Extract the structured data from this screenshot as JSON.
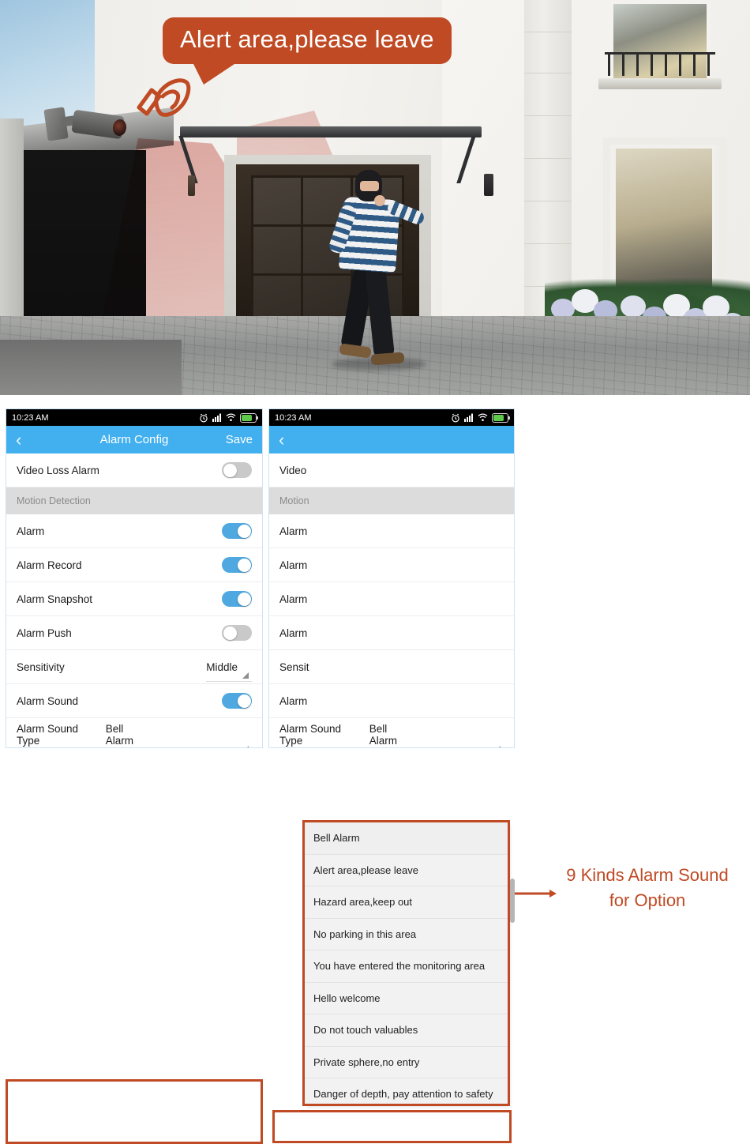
{
  "hero": {
    "bubble_text": "Alert area,please leave",
    "megaphone_icon": "megaphone-icon",
    "accent_color": "#bf4a24"
  },
  "annotation": {
    "line1": "9 Kinds Alarm Sound",
    "line2": "for Option",
    "arrow_icon": "arrow-right-icon",
    "color": "#bf4a24"
  },
  "phone1": {
    "status": {
      "time": "10:23  AM",
      "icons": [
        "alarm-clock-icon",
        "signal-icon",
        "wifi-icon",
        "battery-icon"
      ]
    },
    "nav": {
      "back_icon": "chevron-left-icon",
      "title": "Alarm Config",
      "save_label": "Save"
    },
    "rows": [
      {
        "label": "Video Loss Alarm",
        "type": "toggle",
        "state": "off"
      },
      {
        "label": "Motion Detection",
        "type": "section"
      },
      {
        "label": "Alarm",
        "type": "toggle",
        "state": "on"
      },
      {
        "label": "Alarm Record",
        "type": "toggle",
        "state": "on"
      },
      {
        "label": "Alarm Snapshot",
        "type": "toggle",
        "state": "on"
      },
      {
        "label": "Alarm Push",
        "type": "toggle",
        "state": "off"
      },
      {
        "label": "Sensitivity",
        "type": "select",
        "value": "Middle"
      },
      {
        "label": "Alarm Sound",
        "type": "toggle",
        "state": "on"
      },
      {
        "label": "Alarm Sound Type",
        "type": "select",
        "value": "Bell Alarm"
      }
    ]
  },
  "phone2": {
    "status": {
      "time": "10:23  AM",
      "icons": [
        "alarm-clock-icon",
        "signal-icon",
        "wifi-icon",
        "battery-icon"
      ]
    },
    "nav": {
      "back_icon": "chevron-left-icon",
      "title": "",
      "save_label": ""
    },
    "rows": [
      {
        "label": "Video",
        "type": "toggle",
        "state": "off"
      },
      {
        "label": "Motion",
        "type": "section"
      },
      {
        "label": "Alarm",
        "type": "toggle",
        "state": "on"
      },
      {
        "label": "Alarm",
        "type": "toggle",
        "state": "on"
      },
      {
        "label": "Alarm",
        "type": "toggle",
        "state": "on"
      },
      {
        "label": "Alarm",
        "type": "toggle",
        "state": "off"
      },
      {
        "label": "Sensit",
        "type": "select",
        "value": ""
      },
      {
        "label": "Alarm",
        "type": "toggle",
        "state": "on"
      }
    ],
    "bottom_row": {
      "label": "Alarm Sound Type",
      "value": "Bell Alarm"
    },
    "dropdown": {
      "options": [
        "Bell Alarm",
        "Alert area,please leave",
        "Hazard area,keep out",
        "No parking in this area",
        "You have entered the monitoring area",
        "Hello welcome",
        "Do not touch valuables",
        "Private sphere,no entry",
        "Danger of depth, pay attention to safety"
      ],
      "selected": "Bell Alarm"
    }
  }
}
